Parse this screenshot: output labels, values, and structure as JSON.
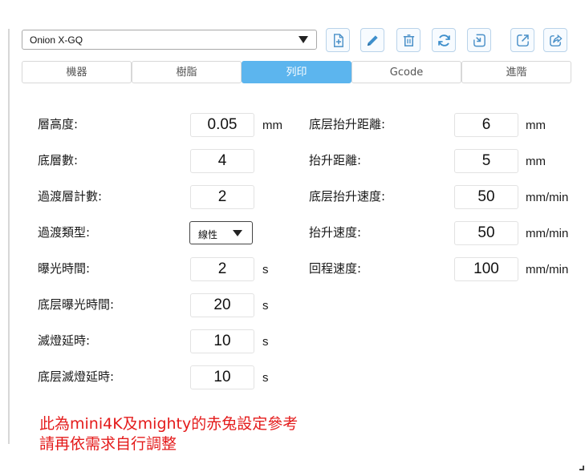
{
  "toolbar": {
    "printer_selected": "Onion X-GQ",
    "buttons": [
      {
        "name": "add-profile-icon"
      },
      {
        "name": "edit-pencil-icon"
      },
      {
        "name": "trash-icon"
      },
      {
        "name": "refresh-icon"
      },
      {
        "name": "import-icon"
      },
      {
        "name": "export-icon"
      },
      {
        "name": "share-icon"
      }
    ],
    "accent_color": "#5cb5ee"
  },
  "tabs": [
    {
      "label": "機器",
      "active": false
    },
    {
      "label": "樹脂",
      "active": false
    },
    {
      "label": "列印",
      "active": true
    },
    {
      "label": "Gcode",
      "active": false
    },
    {
      "label": "進階",
      "active": false
    }
  ],
  "left_fields": [
    {
      "label": "層高度:",
      "value": "0.05",
      "unit": "mm"
    },
    {
      "label": "底層數:",
      "value": "4",
      "unit": ""
    },
    {
      "label": "過渡層計數:",
      "value": "2",
      "unit": ""
    },
    {
      "label": "過渡類型:",
      "value": "線性",
      "unit": ""
    },
    {
      "label": "曝光時間:",
      "value": "2",
      "unit": "s"
    },
    {
      "label": "底层曝光時間:",
      "value": "20",
      "unit": "s"
    },
    {
      "label": "滅燈延時:",
      "value": "10",
      "unit": "s"
    },
    {
      "label": "底层滅燈延時:",
      "value": "10",
      "unit": "s"
    }
  ],
  "right_fields": [
    {
      "label": "底层抬升距離:",
      "value": "6",
      "unit": "mm"
    },
    {
      "label": "抬升距離:",
      "value": "5",
      "unit": "mm"
    },
    {
      "label": "底层抬升速度:",
      "value": "50",
      "unit": "mm/min"
    },
    {
      "label": "抬升速度:",
      "value": "50",
      "unit": "mm/min"
    },
    {
      "label": "回程速度:",
      "value": "100",
      "unit": "mm/min"
    }
  ],
  "notes": [
    "此為mini4K及mighty的赤兔設定參考",
    "請再依需求自行調整"
  ],
  "note_color": "#e41b1b"
}
